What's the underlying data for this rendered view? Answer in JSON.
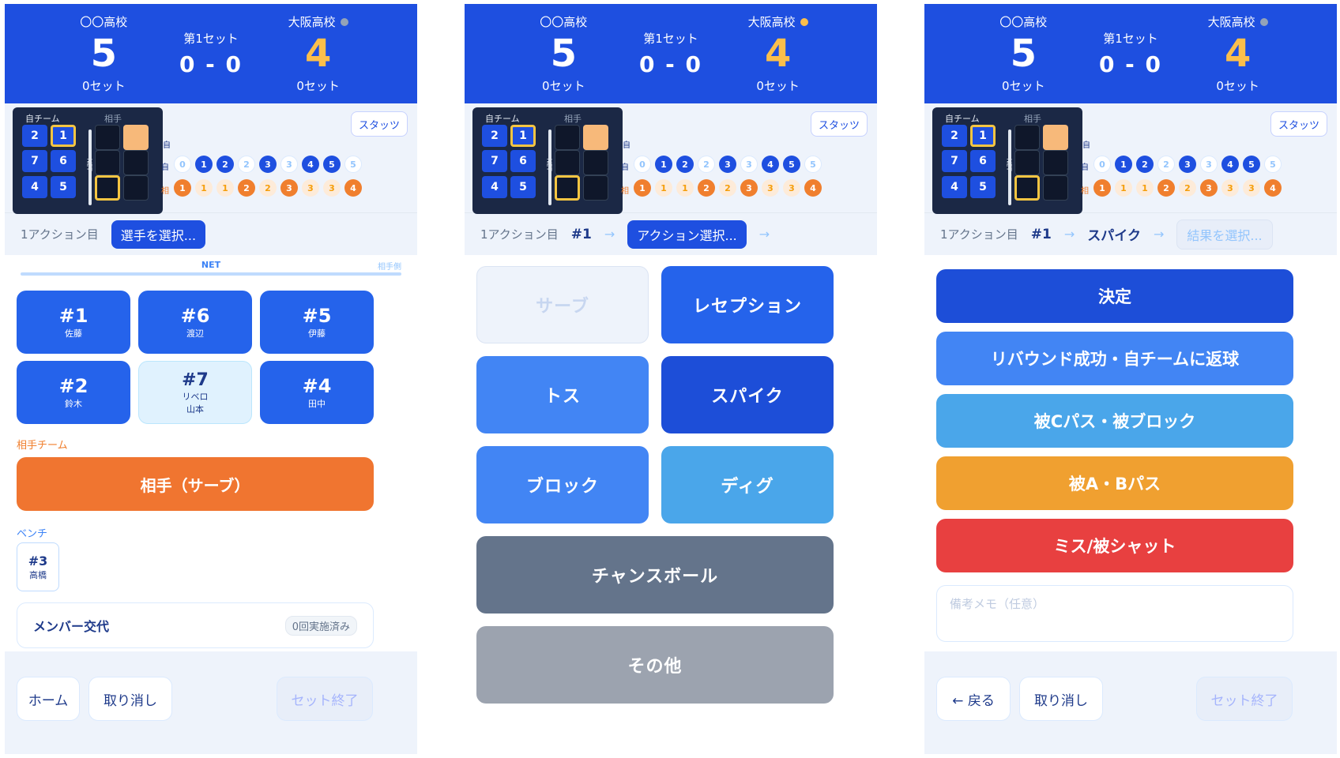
{
  "scoreboard": {
    "home_name": "〇〇高校",
    "home_points": "5",
    "home_sets": "0セット",
    "set_label": "第1セット",
    "set_score": "0 - 0",
    "away_name": "大阪高校",
    "away_points": "4",
    "away_sets": "0セット"
  },
  "court": {
    "own_label": "自チーム",
    "opp_label": "相手",
    "net_label": "NET",
    "positions": [
      "2",
      "1",
      "7",
      "6",
      "4",
      "5"
    ],
    "stats_button": "スタッツ",
    "row_header": "自",
    "own_row_label": "自",
    "opp_row_label": "相",
    "own_chips": [
      "0",
      "1",
      "2",
      "2",
      "3",
      "3",
      "4",
      "5",
      "5"
    ],
    "opp_chips": [
      "1",
      "1",
      "1",
      "2",
      "2",
      "3",
      "3",
      "3",
      "4"
    ]
  },
  "panel1": {
    "breadcrumb_action": "1アクション目",
    "breadcrumb_pill": "選手を選択...",
    "net_label": "NET",
    "opp_side_label": "相手側",
    "players": [
      {
        "number": "#1",
        "name": "佐藤"
      },
      {
        "number": "#6",
        "name": "渡辺"
      },
      {
        "number": "#5",
        "name": "伊藤"
      },
      {
        "number": "#2",
        "name": "鈴木"
      },
      {
        "number": "#7",
        "role": "リベロ",
        "name": "山本"
      },
      {
        "number": "#4",
        "name": "田中"
      }
    ],
    "opp_team_label": "相手チーム",
    "opp_button": "相手（サーブ）",
    "bench_label": "ベンチ",
    "bench_player": {
      "number": "#3",
      "name": "高橋"
    },
    "substitution_label": "メンバー交代",
    "substitution_badge": "0回実施済み",
    "footer": {
      "home": "ホーム",
      "undo": "取り消し",
      "end_set": "セット終了"
    }
  },
  "panel2": {
    "breadcrumb_action": "1アクション目",
    "breadcrumb_player": "#1",
    "breadcrumb_pill": "アクション選択...",
    "actions": [
      "サーブ",
      "レセプション",
      "トス",
      "スパイク",
      "ブロック",
      "ディグ",
      "チャンスボール",
      "その他"
    ]
  },
  "panel3": {
    "breadcrumb_action": "1アクション目",
    "breadcrumb_player": "#1",
    "breadcrumb_action_name": "スパイク",
    "breadcrumb_pill": "結果を選択...",
    "results": [
      "決定",
      "リバウンド成功・自チームに返球",
      "被Cパス・被ブロック",
      "被A・Bパス",
      "ミス/被シャット"
    ],
    "memo_placeholder": "備考メモ（任意）",
    "footer": {
      "back": "← 戻る",
      "undo": "取り消し",
      "end_set": "セット終了"
    }
  },
  "colors": {
    "primary": "#1e4fe0",
    "orange": "#f07530",
    "amber": "#f0a030",
    "red": "#e84040",
    "sky": "#4aa6ea",
    "slate": "#64748b",
    "gray": "#9ca3af"
  }
}
